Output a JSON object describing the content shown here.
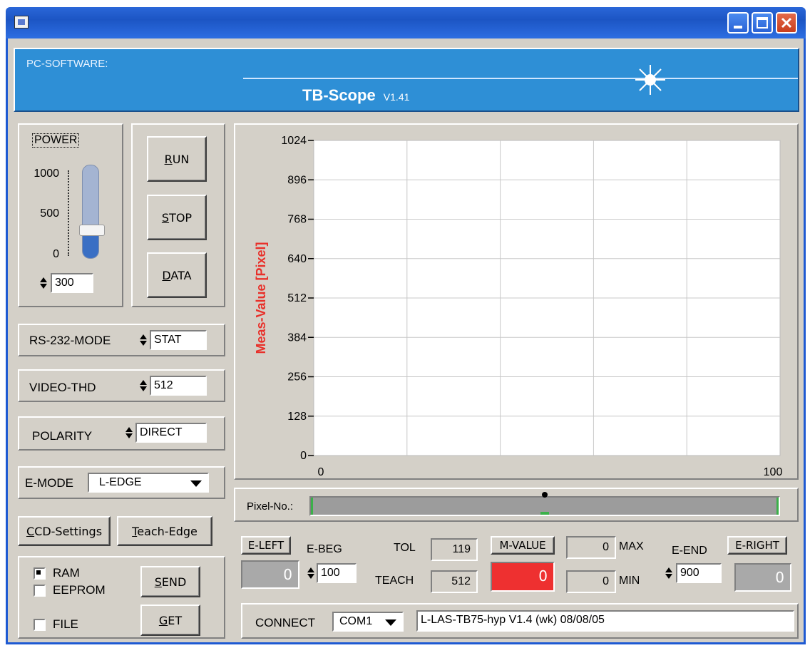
{
  "window": {
    "icon": "app-icon",
    "minimize": "minimize-icon",
    "maximize": "maximize-icon",
    "close": "close-icon"
  },
  "header": {
    "label": "PC-SOFTWARE:",
    "title": "TB-Scope",
    "version": "V1.41",
    "bg_color": "#2e8fd6"
  },
  "power": {
    "label": "POWER",
    "ticks": [
      "1000",
      "500",
      "0"
    ],
    "value": "300",
    "level_fraction": 0.3,
    "fill_color": "#3a6fc4"
  },
  "actions": {
    "run": "RUN",
    "stop": "STOP",
    "data": "DATA"
  },
  "settings": {
    "rs232_label": "RS-232-MODE",
    "rs232_value": "STAT",
    "video_label": "VIDEO-THD",
    "video_value": "512",
    "polarity_label": "POLARITY",
    "polarity_value": "DIRECT",
    "emode_label": "E-MODE",
    "emode_value": "L-EDGE"
  },
  "buttons": {
    "ccd": "CCD-Settings",
    "teach": "Teach-Edge",
    "send": "SEND",
    "get": "GET"
  },
  "storage": {
    "ram": "RAM",
    "ram_checked": true,
    "eeprom": "EEPROM",
    "eeprom_checked": false,
    "file": "FILE",
    "file_checked": false
  },
  "chart_data": {
    "type": "line",
    "ylabel": "Meas-Value  [Pixel]",
    "xlabel": "",
    "yticks": [
      "1024",
      "896",
      "768",
      "640",
      "512",
      "384",
      "256",
      "128",
      "0"
    ],
    "xticks": [
      "0",
      "100"
    ],
    "ylim": [
      0,
      1024
    ],
    "xlim": [
      0,
      100
    ],
    "grid": true,
    "series": []
  },
  "pixel_bar": {
    "label": "Pixel-No.:",
    "marker_position": 0.5
  },
  "values": {
    "e_left_label": "E-LEFT",
    "e_left_value": "0",
    "e_beg_label": "E-BEG",
    "e_beg_value": "100",
    "tol_label": "TOL",
    "tol_value": "119",
    "teach_label": "TEACH",
    "teach_value": "512",
    "mvalue_label": "M-VALUE",
    "mvalue_value": "0",
    "mvalue_color": "#ee3030",
    "max_value": "0",
    "max_label": "MAX",
    "min_value": "0",
    "min_label": "MIN",
    "e_end_label": "E-END",
    "e_end_value": "900",
    "e_right_label": "E-RIGHT",
    "e_right_value": "0"
  },
  "connect": {
    "label": "CONNECT",
    "port": "COM1",
    "status": "L-LAS-TB75-hyp V1.4 (wk) 08/08/05"
  }
}
